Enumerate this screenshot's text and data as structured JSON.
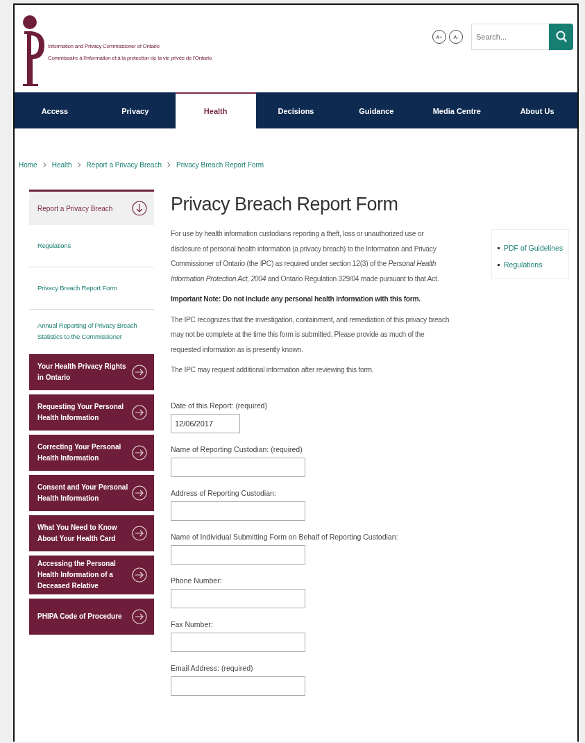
{
  "header": {
    "org_name_en": "Information and Privacy Commissioner of Ontario",
    "org_name_fr": "Commissaire à l'information et à la protection de la vie privée de l'Ontario",
    "font_buttons": [
      "A+",
      "A-"
    ],
    "search": {
      "placeholder": "Search..."
    }
  },
  "nav": [
    {
      "label": "Access",
      "selected": false
    },
    {
      "label": "Privacy",
      "selected": false
    },
    {
      "label": "Health",
      "selected": true
    },
    {
      "label": "Decisions",
      "selected": false
    },
    {
      "label": "Guidance",
      "selected": false
    },
    {
      "label": "Media Centre",
      "selected": false
    },
    {
      "label": "About Us",
      "selected": false
    }
  ],
  "breadcrumb": [
    "Home",
    "Health",
    "Report a Privacy Breach",
    "Privacy Breach Report Form"
  ],
  "sidebar": {
    "section": {
      "label": "Report a Privacy Breach",
      "expanded": true
    },
    "sub_items": [
      "Regulations",
      "Privacy Breach Report Form",
      "Annual Reporting of Privacy Breach Statistics to the Commissioner"
    ],
    "topics": [
      "Your Health Privacy Rights in Ontario",
      "Requesting Your Personal Health Information",
      "Correcting Your Personal Health Information",
      "Consent and Your Personal Health Information",
      "What You Need to Know About Your Health Card",
      "Accessing the Personal Health Information of a Deceased Relative",
      "PHIPA Code of Procedure"
    ]
  },
  "page": {
    "title": "Privacy Breach Report Form",
    "paragraphs": [
      {
        "kind": "text",
        "text": "For use by health information custodians reporting a theft, loss or unauthorized use or disclosure of personal health information (a privacy breach) to the Information and Privacy Commissioner of Ontario (the IPC) as required under section 12(3) of the *Personal Health Information Protection Act, 2004* and Ontario Regulation 329/04 made pursuant to that Act."
      },
      {
        "kind": "note",
        "text": "Important Note: Do not include any personal health information with this form."
      },
      {
        "kind": "text",
        "text": "The IPC recognizes that the investigation, containment, and remediation of this privacy breach may not be complete at the time this form is submitted. Please provide as much of the requested information as is presently known."
      },
      {
        "kind": "text",
        "text": "The IPC may request additional information after reviewing this form."
      }
    ],
    "related_links": [
      "PDF of Guidelines",
      "Regulations"
    ],
    "fields": [
      {
        "label": "Date of this Report: (required)",
        "value": "12/06/2017",
        "kind": "short"
      },
      {
        "label": "Name of Reporting Custodian: (required)",
        "kind": "long"
      },
      {
        "label": "Address of Reporting Custodian:",
        "kind": "long"
      },
      {
        "label": "Name of Individual Submitting Form on Behalf of Reporting Custodian:",
        "kind": "long"
      },
      {
        "label": "Phone Number:",
        "kind": "long"
      },
      {
        "label": "Fax Number:",
        "kind": "long"
      },
      {
        "label": "Email Address: (required)",
        "kind": "long"
      }
    ]
  }
}
